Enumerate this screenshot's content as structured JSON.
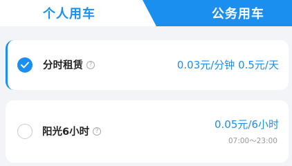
{
  "tabs": {
    "personal": "个人用车",
    "business": "公务用车"
  },
  "colors": {
    "accent": "#1a8ff0",
    "muted": "#999999"
  },
  "options": [
    {
      "name": "分时租赁",
      "price": "0.03元/分钟 0.5元/天",
      "selected": true,
      "help_icon": "question-circle-icon"
    },
    {
      "name": "阳光6小时",
      "price": "0.05元/6小时",
      "hours": "07:00～23:00",
      "selected": false,
      "help_icon": "question-circle-icon"
    }
  ],
  "help_glyph": "?"
}
